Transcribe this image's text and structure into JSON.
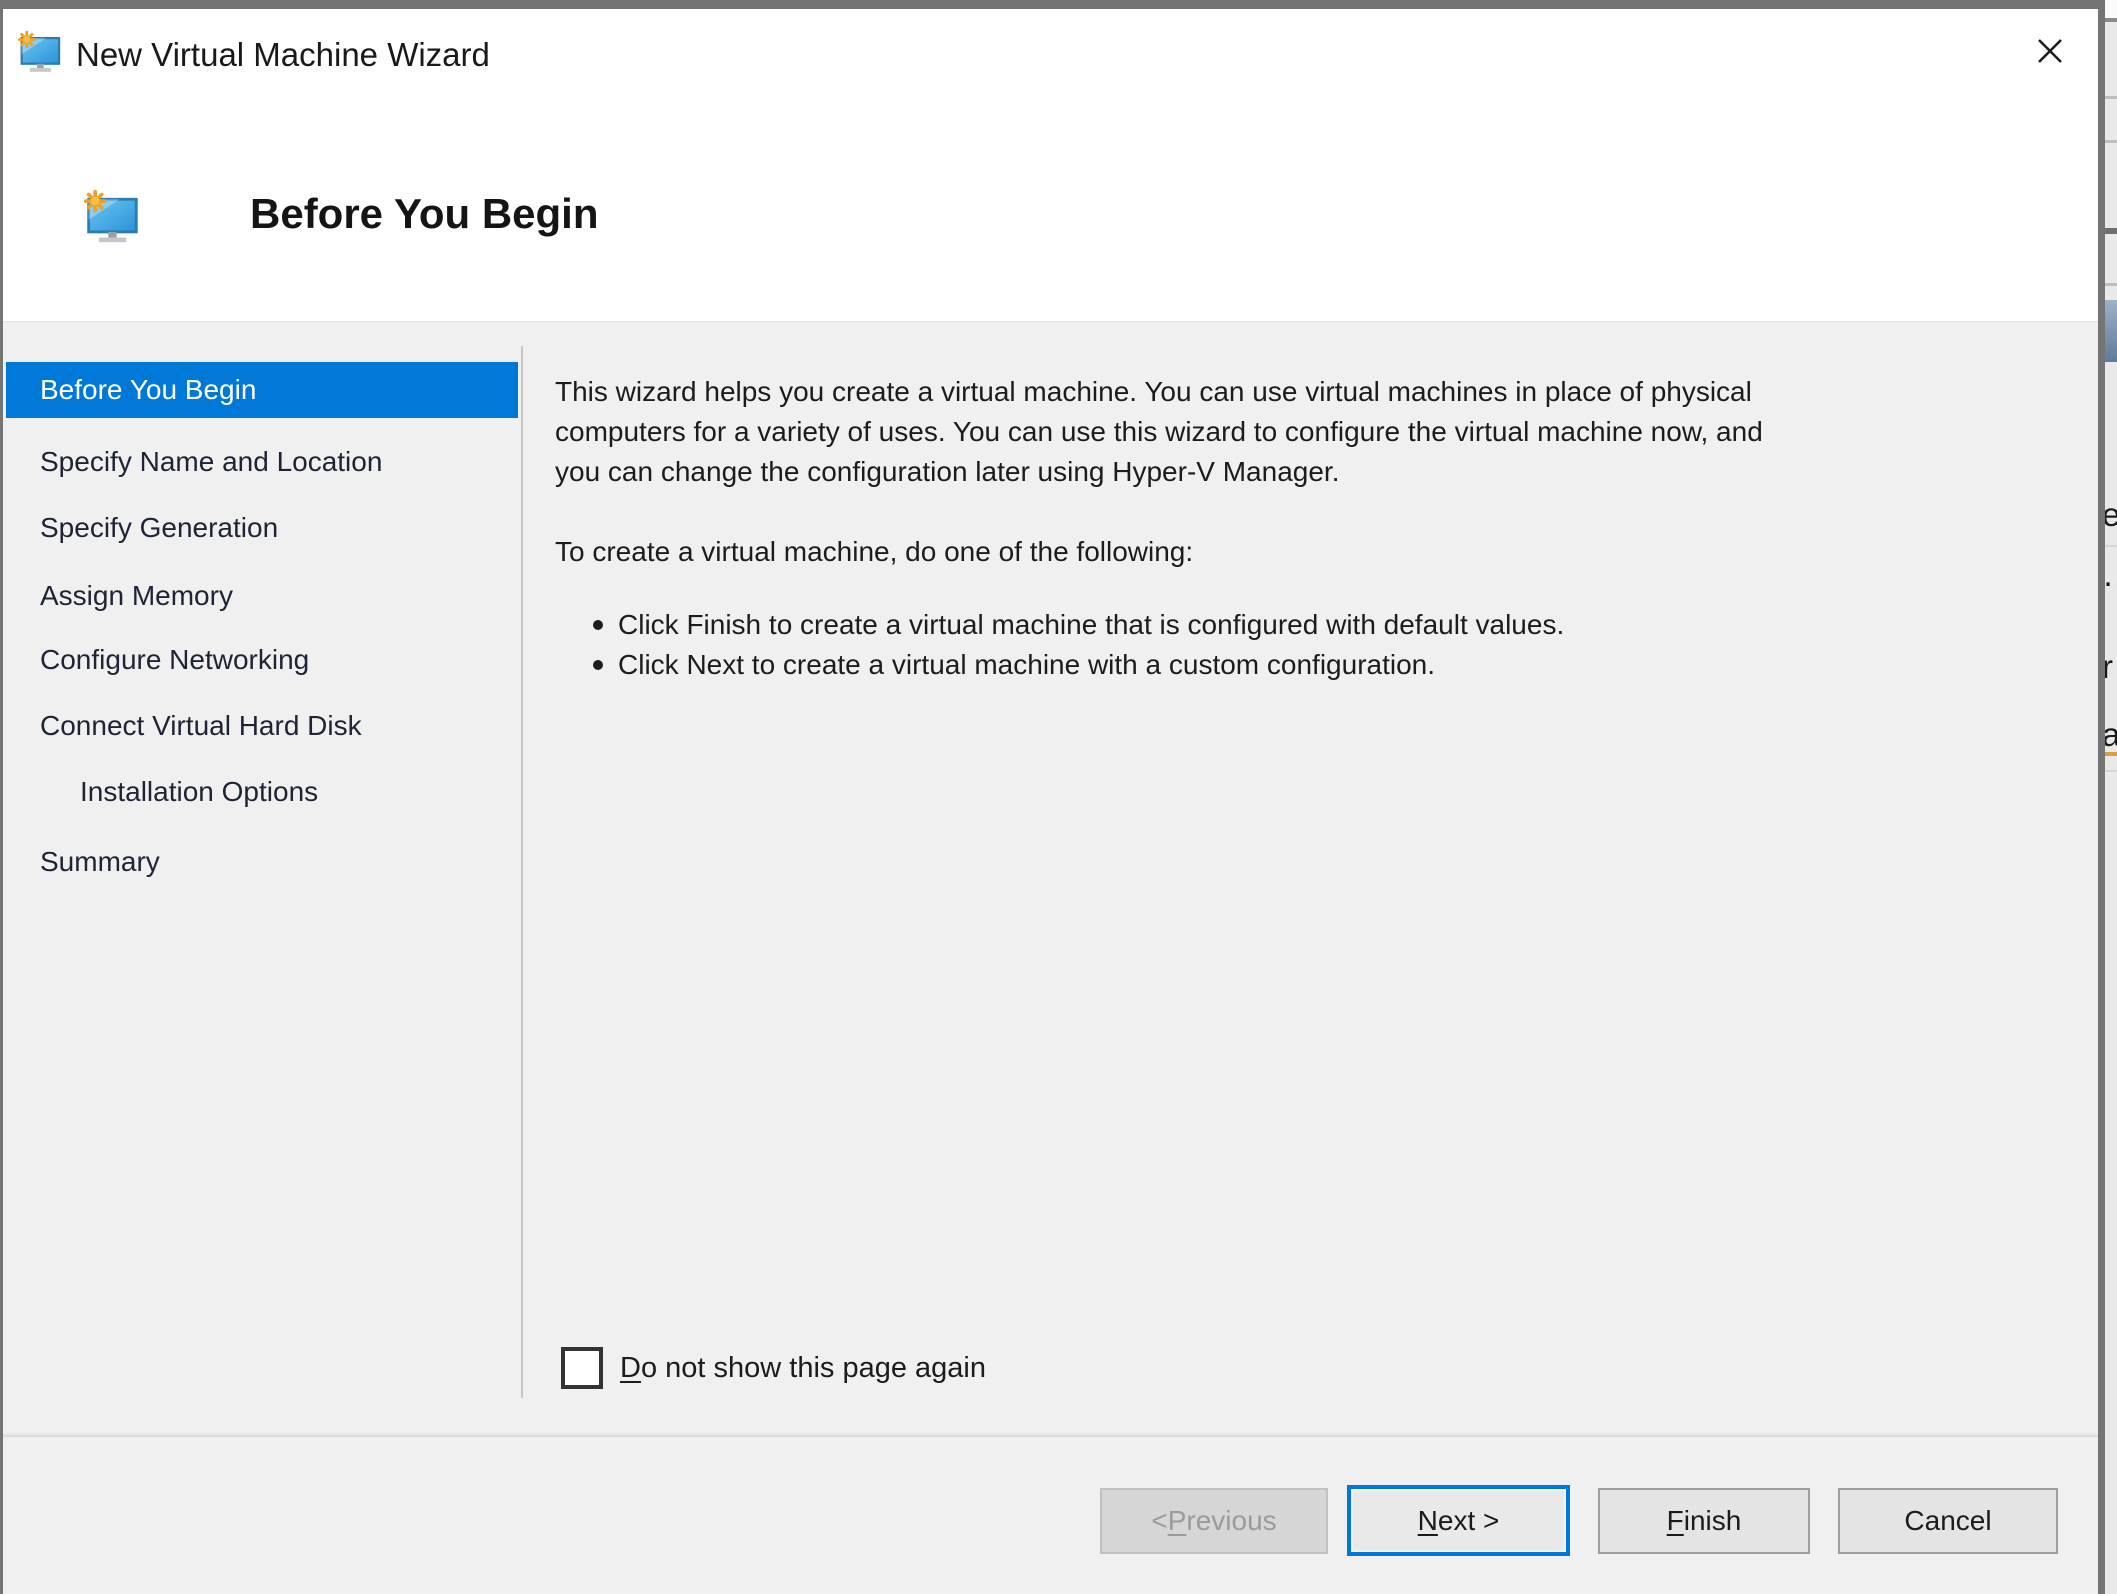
{
  "window": {
    "title": "New Virtual Machine Wizard"
  },
  "header": {
    "title": "Before You Begin"
  },
  "sidebar": {
    "items": [
      {
        "label": "Before You Begin",
        "selected": true,
        "indent": false
      },
      {
        "label": "Specify Name and Location",
        "selected": false,
        "indent": false
      },
      {
        "label": "Specify Generation",
        "selected": false,
        "indent": false
      },
      {
        "label": "Assign Memory",
        "selected": false,
        "indent": false
      },
      {
        "label": "Configure Networking",
        "selected": false,
        "indent": false
      },
      {
        "label": "Connect Virtual Hard Disk",
        "selected": false,
        "indent": false
      },
      {
        "label": "Installation Options",
        "selected": false,
        "indent": true
      },
      {
        "label": "Summary",
        "selected": false,
        "indent": false
      }
    ]
  },
  "content": {
    "intro_lines": [
      "This wizard helps you create a virtual machine. You can use virtual machines in place of physical",
      "computers for a variety of uses. You can use this wizard to configure the virtual machine now, and",
      "you can change the configuration later using Hyper-V Manager."
    ],
    "instruction": "To create a virtual machine, do one of the following:",
    "bullets": [
      "Click Finish to create a virtual machine that is configured with default values.",
      "Click Next to create a virtual machine with a custom configuration."
    ],
    "checkbox": {
      "checked": false,
      "label_key": "D",
      "label_rest": "o not show this page again"
    }
  },
  "buttons": {
    "previous": {
      "pre": "< ",
      "key": "P",
      "rest": "revious",
      "disabled": true
    },
    "next": {
      "pre": "",
      "key": "N",
      "rest": "ext >",
      "default": true
    },
    "finish": {
      "pre": "",
      "key": "F",
      "rest": "inish",
      "disabled": false
    },
    "cancel": {
      "pre": "Cancel",
      "key": "",
      "rest": "",
      "disabled": false
    }
  },
  "background_fragments": {
    "letters": [
      "e",
      "…",
      "r",
      "a"
    ]
  },
  "colors": {
    "accent": "#0078d7",
    "selected_step_bg": "#0078d7",
    "selected_step_text": "#ffffff",
    "frame_border": "#747474",
    "content_bg": "#f0f0f0"
  }
}
